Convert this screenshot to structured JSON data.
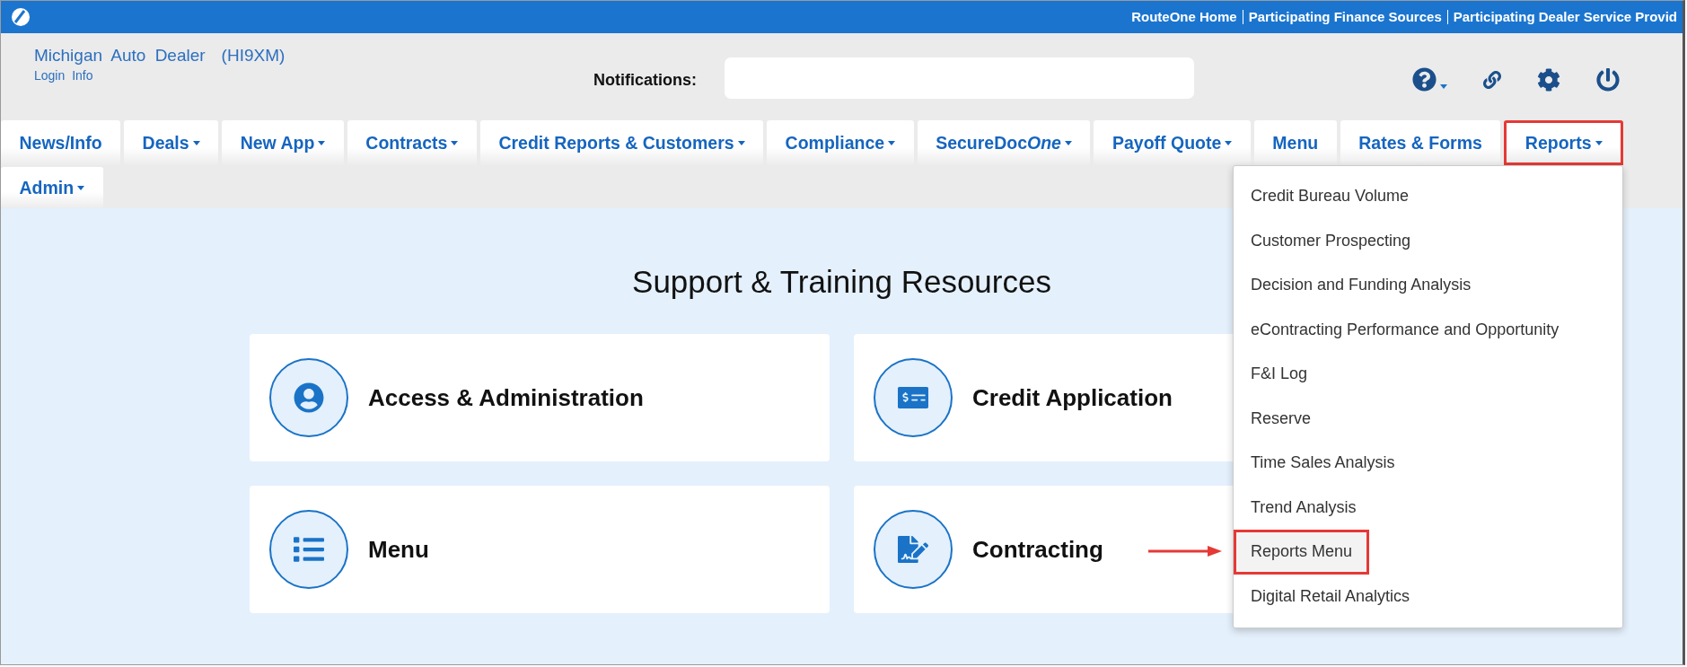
{
  "top_bar": {
    "links": [
      "RouteOne Home",
      "Participating Finance Sources",
      "Participating Dealer Service Provid"
    ]
  },
  "header": {
    "dealer_name": "Michigan Auto Dealer",
    "dealer_code": "(HI9XM)",
    "login_info": "Login Info",
    "notifications": {
      "label": "Notifications:"
    }
  },
  "nav_rows": [
    [
      {
        "label": "News/Info",
        "dropdown": false,
        "highlighted": false
      },
      {
        "label": "Deals",
        "dropdown": true,
        "highlighted": false
      },
      {
        "label": "New App",
        "dropdown": true,
        "highlighted": false
      },
      {
        "label": "Contracts",
        "dropdown": true,
        "highlighted": false
      },
      {
        "label": "Credit Reports & Customers",
        "dropdown": true,
        "highlighted": false
      },
      {
        "label": "Compliance",
        "dropdown": true,
        "highlighted": false
      },
      {
        "label": "SecureDoc",
        "label_italic": "One",
        "dropdown": true,
        "highlighted": false
      },
      {
        "label": "Payoff Quote",
        "dropdown": true,
        "highlighted": false
      },
      {
        "label": "Menu",
        "dropdown": false,
        "highlighted": false
      },
      {
        "label": "Rates & Forms",
        "dropdown": false,
        "highlighted": false
      },
      {
        "label": "Reports",
        "dropdown": true,
        "highlighted": true,
        "open": true,
        "menu": [
          {
            "label": "Credit Bureau Volume",
            "highlighted": false
          },
          {
            "label": "Customer Prospecting",
            "highlighted": false
          },
          {
            "label": "Decision and Funding Analysis",
            "highlighted": false
          },
          {
            "label": "eContracting Performance and Opportunity",
            "highlighted": false
          },
          {
            "label": "F&I Log",
            "highlighted": false
          },
          {
            "label": "Reserve",
            "highlighted": false
          },
          {
            "label": "Time Sales Analysis",
            "highlighted": false
          },
          {
            "label": "Trend Analysis",
            "highlighted": false
          },
          {
            "label": "Reports Menu",
            "highlighted": true
          },
          {
            "label": "Digital Retail Analytics",
            "highlighted": false
          }
        ]
      }
    ],
    [
      {
        "label": "Admin",
        "dropdown": true,
        "highlighted": false
      }
    ]
  ],
  "content": {
    "title": "Support & Training Resources",
    "cards": [
      {
        "title": "Access & Administration",
        "kind": "user"
      },
      {
        "title": "Credit Application",
        "kind": "check"
      },
      {
        "title": "Menu",
        "kind": "list"
      },
      {
        "title": "Contracting",
        "kind": "signature"
      }
    ]
  }
}
